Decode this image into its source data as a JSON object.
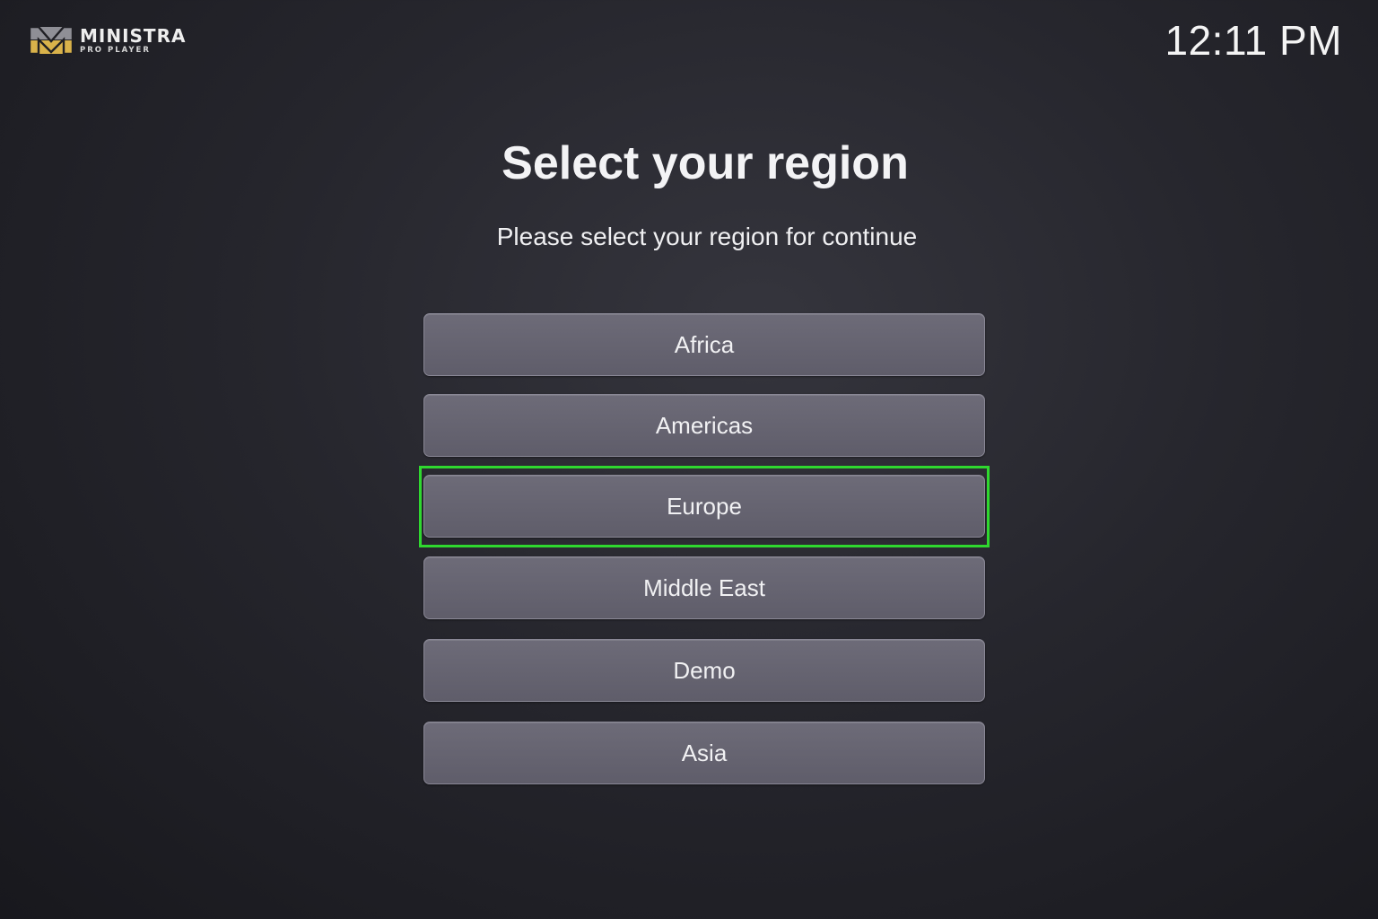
{
  "header": {
    "logo_name": "MINISTRA",
    "logo_sub": "PRO PLAYER",
    "logo_icon": "ministra-m-logo",
    "clock": "12:11 PM"
  },
  "main": {
    "title": "Select your region",
    "subtitle": "Please select your region for continue"
  },
  "regions": [
    {
      "label": "Africa"
    },
    {
      "label": "Americas"
    },
    {
      "label": "Europe"
    },
    {
      "label": "Middle East"
    },
    {
      "label": "Demo"
    },
    {
      "label": "Asia"
    }
  ],
  "focused_region": "Europe",
  "colors": {
    "focus": "#2fd82f",
    "logo_gold": "#d9b24a",
    "logo_grey": "#8f8f96"
  }
}
